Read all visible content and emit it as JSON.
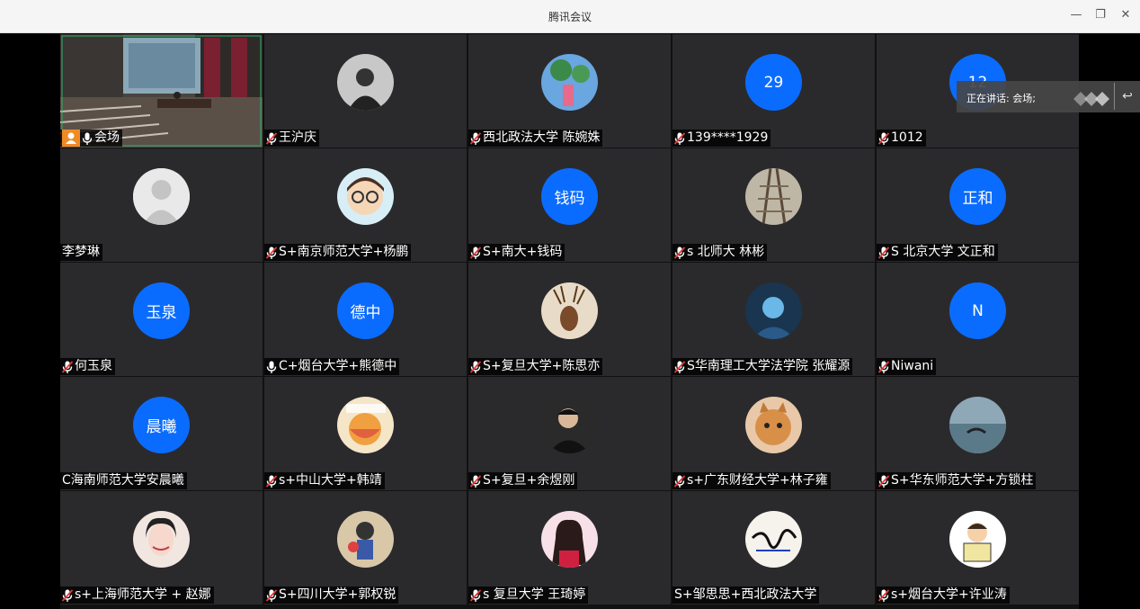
{
  "window": {
    "title": "腾讯会议",
    "minimize": "—",
    "restore": "❐",
    "close": "✕"
  },
  "speaking": {
    "text": "正在讲话: 会场;",
    "back_icon": "↩"
  },
  "participants": [
    {
      "name": "会场",
      "type": "video",
      "mic": "on",
      "host": true
    },
    {
      "name": "王沪庆",
      "type": "photo",
      "mic": "off",
      "photo": "p1"
    },
    {
      "name": "西北政法大学 陈婉姝",
      "type": "photo",
      "mic": "off",
      "photo": "p2"
    },
    {
      "name": "139****1929",
      "type": "text",
      "avatar_text": "29",
      "mic": "off"
    },
    {
      "name": "1012",
      "type": "text",
      "avatar_text": "12",
      "mic": "off"
    },
    {
      "name": "李梦琳",
      "type": "default",
      "mic": "none"
    },
    {
      "name": "S+南京师范大学+杨鹏",
      "type": "photo",
      "mic": "off",
      "photo": "p3"
    },
    {
      "name": "S+南大+钱码",
      "type": "text",
      "avatar_text": "钱码",
      "mic": "off"
    },
    {
      "name": "s 北师大 林彬",
      "type": "photo",
      "mic": "off",
      "photo": "p4"
    },
    {
      "name": "S 北京大学 文正和",
      "type": "text",
      "avatar_text": "正和",
      "mic": "off"
    },
    {
      "name": "何玉泉",
      "type": "text",
      "avatar_text": "玉泉",
      "mic": "off"
    },
    {
      "name": "C+烟台大学+熊德中",
      "type": "text",
      "avatar_text": "德中",
      "mic": "on"
    },
    {
      "name": "S+复旦大学+陈思亦",
      "type": "photo",
      "mic": "off",
      "photo": "p5"
    },
    {
      "name": "S华南理工大学法学院 张耀源",
      "type": "photo",
      "mic": "off",
      "photo": "p6"
    },
    {
      "name": "Niwani",
      "type": "text",
      "avatar_text": "N",
      "mic": "off"
    },
    {
      "name": "C海南师范大学安晨曦",
      "type": "text",
      "avatar_text": "晨曦",
      "mic": "none"
    },
    {
      "name": "s+中山大学+韩靖",
      "type": "photo",
      "mic": "off",
      "photo": "p7"
    },
    {
      "name": "S+复旦+余煜刚",
      "type": "photo",
      "mic": "off",
      "photo": "p8"
    },
    {
      "name": "s+广东财经大学+林子雍",
      "type": "photo",
      "mic": "off",
      "photo": "p9"
    },
    {
      "name": "S+华东师范大学+方锁柱",
      "type": "photo",
      "mic": "off",
      "photo": "p10"
    },
    {
      "name": "s+上海师范大学 + 赵娜",
      "type": "photo",
      "mic": "off",
      "photo": "p11"
    },
    {
      "name": "S+四川大学+郭权锐",
      "type": "photo",
      "mic": "off",
      "photo": "p12"
    },
    {
      "name": "s 复旦大学 王琦婷",
      "type": "photo",
      "mic": "off",
      "photo": "p13"
    },
    {
      "name": "S+邹思思+西北政法大学",
      "type": "photo",
      "mic": "none",
      "photo": "p14"
    },
    {
      "name": "s+烟台大学+许业涛",
      "type": "photo",
      "mic": "off",
      "photo": "p15"
    }
  ],
  "colors": {
    "avatar_blue": "#0a6cff",
    "tile_bg": "#2a2a2d",
    "active_border": "#2fb16c",
    "host_badge": "#f08a24"
  }
}
